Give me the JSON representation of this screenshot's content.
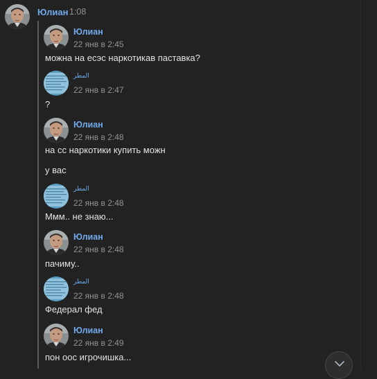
{
  "header": {
    "name": "Юлиан",
    "time": "1:08"
  },
  "messages": [
    {
      "author": "Юлиан",
      "date": "22 янв в 2:45",
      "texts": [
        "можна на есэс наркотикав паставка?"
      ]
    },
    {
      "author": "المطر",
      "date": "22 янв в 2:47",
      "texts": [
        "?"
      ]
    },
    {
      "author": "Юлиан",
      "date": "22 янв в 2:48",
      "texts": [
        "на сс наркотики купить можн",
        "у вас"
      ]
    },
    {
      "author": "المطر",
      "date": "22 янв в 2:48",
      "texts": [
        "Ммм.. не знаю..."
      ]
    },
    {
      "author": "Юлиан",
      "date": "22 янв в 2:48",
      "texts": [
        "пачиму.."
      ]
    },
    {
      "author": "المطر",
      "date": "22 янв в 2:48",
      "texts": [
        "Федерал фед"
      ]
    },
    {
      "author": "Юлиан",
      "date": "22 янв в 2:49",
      "texts": [
        "пон оос игрочишка..."
      ]
    }
  ],
  "icons": {
    "scroll_down": "chevron-down-icon",
    "user_avatar": "avatar-photo-icon",
    "other_avatar": "avatar-document-icon"
  },
  "colors": {
    "background": "#222222",
    "author": "#71aaeb",
    "meta": "#939393",
    "text": "#e1e3e6"
  }
}
